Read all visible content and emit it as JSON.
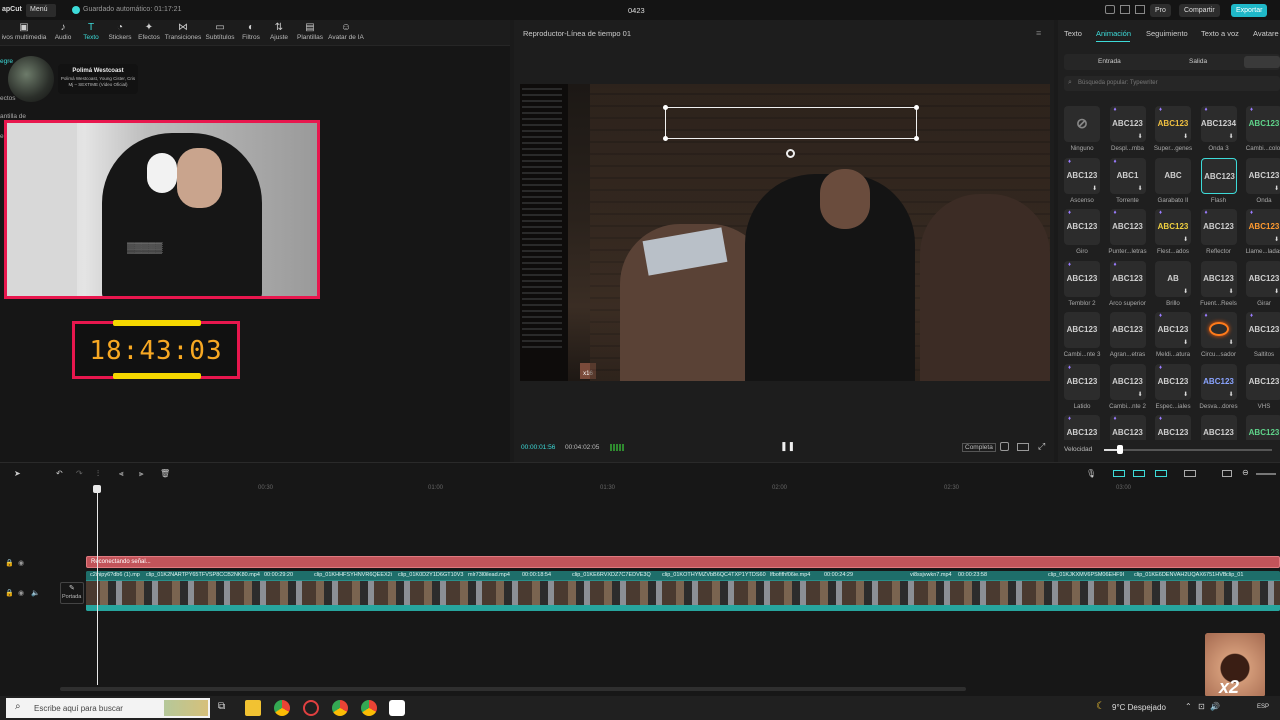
{
  "topbar": {
    "app_name": "apCut",
    "menu_label": "Menú",
    "autosave": "Guardado automático: 01:17:21",
    "project_name": "0423",
    "pro_label": "Pro",
    "share_label": "Compartir",
    "export_label": "Exportar"
  },
  "toolbar": {
    "items": [
      {
        "label": "ivos multimedia",
        "icon": "media-icon"
      },
      {
        "label": "Audio",
        "icon": "audio-icon"
      },
      {
        "label": "Texto",
        "icon": "text-icon"
      },
      {
        "label": "Stickers",
        "icon": "sticker-icon"
      },
      {
        "label": "Efectos",
        "icon": "effects-icon"
      },
      {
        "label": "Transiciones",
        "icon": "transition-icon"
      },
      {
        "label": "Subtítulos",
        "icon": "subtitle-icon"
      },
      {
        "label": "Filtros",
        "icon": "filter-icon"
      },
      {
        "label": "Ajuste",
        "icon": "adjust-icon"
      },
      {
        "label": "Plantillas",
        "icon": "template-icon"
      },
      {
        "label": "Avatar de IA",
        "icon": "avatar-icon"
      }
    ]
  },
  "leftpanel": {
    "side_labels": [
      "egre",
      "ectos",
      "antilla de",
      "e"
    ],
    "music_title": "Polimá Westcoast",
    "music_sub": "Polimá Westcoast, Young Cister, Cris Mj – SEXTIME (Video Oficial)",
    "timer": "18:43:03"
  },
  "player": {
    "title": "Reproductor-Línea de tiempo 01",
    "current_time": "00:00:01:56",
    "total_time": "00:04:02:05",
    "complete_label": "Completa",
    "chat_badge": "x16"
  },
  "rightpanel": {
    "tabs": [
      "Texto",
      "Animación",
      "Seguimiento",
      "Texto a voz",
      "Avatare"
    ],
    "active_tab": "Animación",
    "subtabs": [
      "Entrada",
      "Salida"
    ],
    "search_placeholder": "Búsqueda popular: Typewriter",
    "speed_label": "Velocidad",
    "tiles": [
      {
        "sample": "",
        "label": "Ninguno",
        "download": false,
        "premium": false,
        "none": true
      },
      {
        "sample": "ABC123",
        "label": "Despl...mba",
        "download": true,
        "premium": true
      },
      {
        "sample": "ABC123",
        "label": "Super...genes",
        "download": true,
        "premium": true,
        "color": "#f0c040"
      },
      {
        "sample": "ABC1234",
        "label": "Onda 3",
        "download": true,
        "premium": true
      },
      {
        "sample": "ABC123",
        "label": "Cambi...color",
        "download": false,
        "premium": true,
        "color": "#5fd38a"
      },
      {
        "sample": "ABC123",
        "label": "Ascenso",
        "download": true,
        "premium": true
      },
      {
        "sample": "ABC1",
        "label": "Torrente",
        "download": true,
        "premium": true
      },
      {
        "sample": "ABC",
        "label": "Garabato II",
        "download": false,
        "premium": false
      },
      {
        "sample": "ABC123",
        "label": "Flash",
        "download": false,
        "premium": false,
        "selected": true
      },
      {
        "sample": "ABC123",
        "label": "Onda",
        "download": true,
        "premium": false
      },
      {
        "sample": "ABC123",
        "label": "Giro",
        "download": false,
        "premium": true
      },
      {
        "sample": "ABC123",
        "label": "Punter...letras",
        "download": false,
        "premium": true
      },
      {
        "sample": "ABC123",
        "label": "Flest...ados",
        "download": true,
        "premium": true,
        "color": "#f0d040"
      },
      {
        "sample": "ABC123",
        "label": "Reflector",
        "download": false,
        "premium": true
      },
      {
        "sample": "ABC123",
        "label": "Llame...ladas",
        "download": true,
        "premium": true,
        "color": "#ff9a30"
      },
      {
        "sample": "ABC123",
        "label": "Temblor 2",
        "download": false,
        "premium": true
      },
      {
        "sample": "ABC123",
        "label": "Arco superior",
        "download": false,
        "premium": true
      },
      {
        "sample": "AB",
        "label": "Brillo",
        "download": true,
        "premium": false
      },
      {
        "sample": "ABC123",
        "label": "Fuent...Reels",
        "download": true,
        "premium": false
      },
      {
        "sample": "ABC123",
        "label": "Girar",
        "download": true,
        "premium": false
      },
      {
        "sample": "ABC123",
        "label": "Cambi...nte 3",
        "download": false,
        "premium": false
      },
      {
        "sample": "ABC123",
        "label": "Agran...etras",
        "download": false,
        "premium": false
      },
      {
        "sample": "ABC123",
        "label": "Meldi...atura",
        "download": true,
        "premium": true
      },
      {
        "sample": "",
        "label": "Circu...sador",
        "download": true,
        "premium": true,
        "ring": true
      },
      {
        "sample": "ABC123",
        "label": "Saltitos",
        "download": false,
        "premium": true
      },
      {
        "sample": "ABC123",
        "label": "Latido",
        "download": false,
        "premium": true
      },
      {
        "sample": "ABC123",
        "label": "Cambi...nte 2",
        "download": true,
        "premium": false
      },
      {
        "sample": "ABC123",
        "label": "Espec...iales",
        "download": true,
        "premium": true
      },
      {
        "sample": "ABC123",
        "label": "Desva...dores",
        "download": true,
        "premium": false,
        "color": "#8aa4ff"
      },
      {
        "sample": "ABC123",
        "label": "VHS",
        "download": false,
        "premium": false
      },
      {
        "sample": "ABC123",
        "label": "",
        "download": false,
        "premium": true
      },
      {
        "sample": "ABC123",
        "label": "",
        "download": false,
        "premium": true
      },
      {
        "sample": "ABC123",
        "label": "",
        "download": false,
        "premium": true
      },
      {
        "sample": "ABC123",
        "label": "",
        "download": false,
        "premium": false
      },
      {
        "sample": "ABC123",
        "label": "",
        "download": false,
        "premium": false,
        "color": "#5fd38a"
      }
    ]
  },
  "timeline": {
    "ruler_labels": [
      "00:30",
      "01:00",
      "01:30",
      "02:00",
      "02:30",
      "03:00"
    ],
    "text_track_label": "Reconectando señal...",
    "cover_label": "Portada",
    "clips": [
      {
        "name": "c2inipy6?db6 (1).mp"
      },
      {
        "name": "clip_01K2NARTPY65TFVSP8CCB2NK80.mp4"
      },
      {
        "name": "00:00:29:20"
      },
      {
        "name": "clip_01KHHFSYHNVR6QEEX2i"
      },
      {
        "name": "clip_01K0D2Y1D6GT10V3"
      },
      {
        "name": "mlr73l0ilead.mp4"
      },
      {
        "name": "00:00:18:54"
      },
      {
        "name": "clip_01KE6RVXDZ7C7EDVE3Q"
      },
      {
        "name": "clip_01KOTHYMZVbB6QC4TXP1YTDS60"
      },
      {
        "name": "lfbofifhf06ie.mp4"
      },
      {
        "name": "00:00:24:29"
      },
      {
        "name": "vi8ssjvwkn7.mp4"
      },
      {
        "name": "00:00:23:58"
      },
      {
        "name": "clip_01KJKXMV6PSM06EHF9I"
      },
      {
        "name": "clip_01KE6DENVAH2UQAX6751HVB"
      },
      {
        "name": "clip_01"
      }
    ]
  },
  "taskbar": {
    "search_placeholder": "Escribe aquí para buscar",
    "weather": "9°C Despejado",
    "lang": "ESP",
    "overlay_badge": "x2"
  },
  "colors": {
    "accent": "#3ddbd9",
    "export": "#1fb8c8",
    "cam_border": "#e8174e",
    "timer_yellow": "#f5d800",
    "text_track": "#c2545a",
    "video_track": "#2a8f8a"
  }
}
